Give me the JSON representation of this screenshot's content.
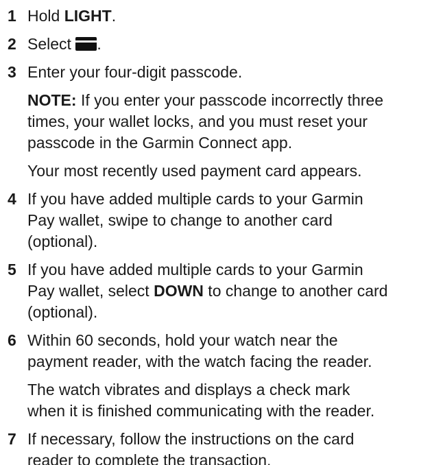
{
  "steps": [
    {
      "number": "1",
      "pre": "Hold ",
      "bold": "LIGHT",
      "post": "."
    },
    {
      "number": "2",
      "pre": "Select ",
      "icon": "wallet-card-icon",
      "post": "."
    },
    {
      "number": "3",
      "lines": [
        "Enter your four-digit passcode."
      ],
      "note_label": "NOTE:",
      "note_lines": [
        " If you enter your passcode incorrectly three",
        "times, your wallet locks, and you must reset your",
        "passcode in the Garmin Connect app."
      ],
      "result_lines": [
        "Your most recently used payment card appears."
      ]
    },
    {
      "number": "4",
      "lines": [
        "If you have added multiple cards to your Garmin",
        "Pay wallet, swipe to change to another card",
        "(optional)."
      ]
    },
    {
      "number": "5",
      "line1": "If you have added multiple cards to your Garmin",
      "line2_pre": "Pay wallet, select ",
      "line2_bold": "DOWN",
      "line2_post": " to change to another card",
      "line3": "(optional)."
    },
    {
      "number": "6",
      "lines": [
        "Within 60 seconds, hold your watch near the",
        "payment reader, with the watch facing the reader."
      ],
      "result_lines": [
        "The watch vibrates and displays a check mark",
        "when it is finished communicating with the reader."
      ]
    },
    {
      "number": "7",
      "lines": [
        "If necessary, follow the instructions on the card",
        "reader to complete the transaction."
      ]
    }
  ]
}
